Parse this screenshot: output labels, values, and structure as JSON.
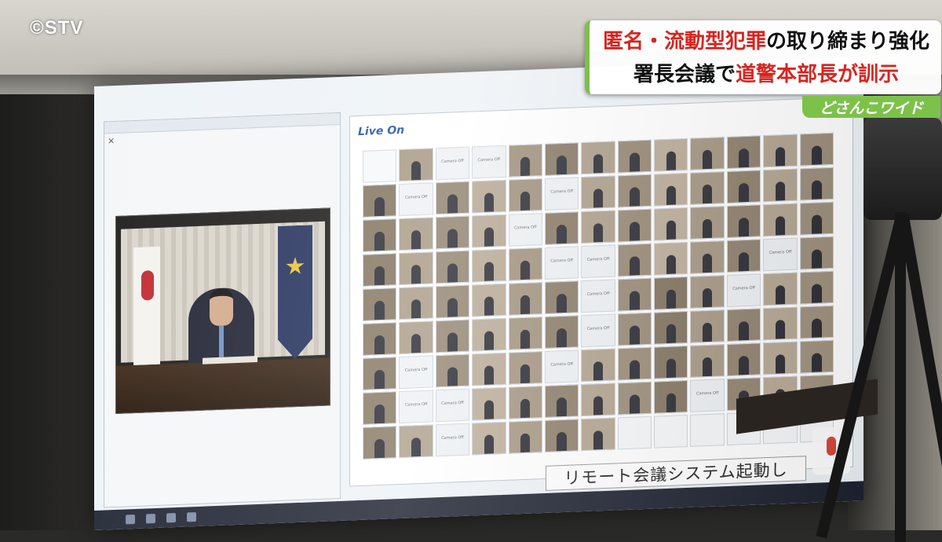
{
  "watermark": "©STV",
  "telop": {
    "line1": {
      "red": "匿名・流動型犯罪",
      "dark": "の取り締まり強化"
    },
    "line2": {
      "dark_a": "署長会議で",
      "red": "道警本部長が訓示"
    }
  },
  "program": "どさんこワイド",
  "screen": {
    "app_logo": "Live On",
    "caption": "リモート会議システム起動し",
    "camera_off_label": "Camera Off"
  }
}
